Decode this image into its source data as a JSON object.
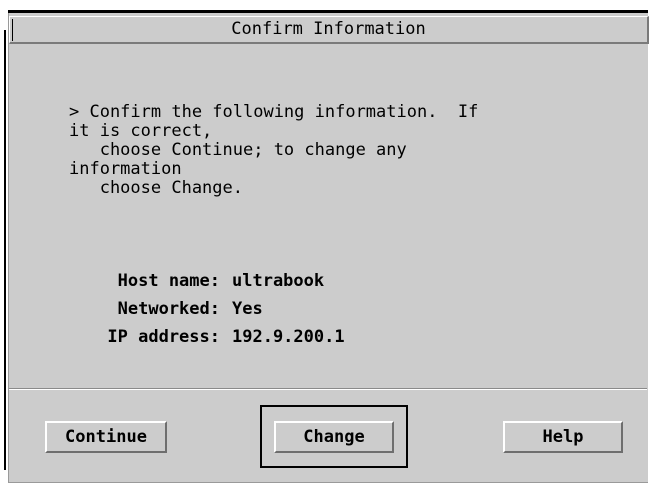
{
  "dialog": {
    "title": "Confirm Information",
    "message": "> Confirm the following information.  If\nit is correct,\n   choose Continue; to change any\ninformation\n   choose Change.",
    "fields": [
      {
        "label": "Host name:",
        "value": "ultrabook"
      },
      {
        "label": "Networked:",
        "value": "Yes"
      },
      {
        "label": "IP address:",
        "value": "192.9.200.1"
      }
    ],
    "buttons": {
      "continue_label": "Continue",
      "change_label": "Change",
      "help_label": "Help",
      "default_button": "Change"
    }
  },
  "colors": {
    "background": "#cccccc",
    "text": "#000000",
    "highlight": "#ffffff",
    "shadow": "#6e6e6e"
  }
}
